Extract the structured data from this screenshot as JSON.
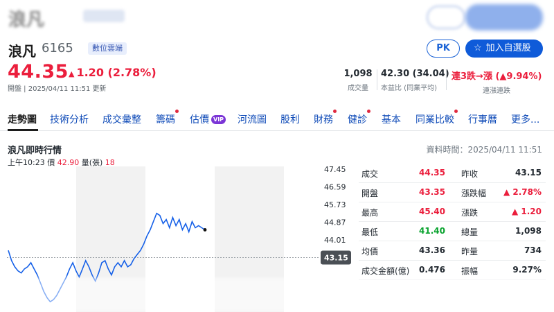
{
  "stock": {
    "name": "浪凡",
    "code": "6165",
    "tag": "數位雲端",
    "price": "44.35",
    "change": "1.20 (2.78%)",
    "status": "開盤 | 2025/04/11 11:51 更新"
  },
  "buttons": {
    "pk": "PK",
    "add": "加入自選股"
  },
  "metrics": [
    {
      "value": "1,098",
      "label": "成交量"
    },
    {
      "value": "42.30 (34.04)",
      "label": "本益比 (同業平均)"
    },
    {
      "value": "連3跌→漲 (▲9.94%)",
      "label": "連漲連跌"
    }
  ],
  "nav": [
    {
      "label": "走勢圖",
      "active": true
    },
    {
      "label": "技術分析"
    },
    {
      "label": "成交彙整"
    },
    {
      "label": "籌碼",
      "dot": true
    },
    {
      "label": "估價",
      "vip": "VIP"
    },
    {
      "label": "河流圖"
    },
    {
      "label": "股利"
    },
    {
      "label": "財務",
      "dot": true
    },
    {
      "label": "健診",
      "dot": true
    },
    {
      "label": "基本"
    },
    {
      "label": "同業比較",
      "dot": true
    },
    {
      "label": "行事曆"
    },
    {
      "label": "更多..."
    }
  ],
  "realtime": {
    "title": "浪凡即時行情",
    "data_time": "資料時間：2025/04/11 11:51",
    "tick_time": "上午10:23",
    "price_label": "價",
    "price_value": "42.90",
    "vol_label": "量(張)",
    "vol_value": "18"
  },
  "chart_data": {
    "type": "line",
    "y_ticks": [
      "47.45",
      "46.59",
      "45.73",
      "44.87",
      "44.01",
      "43.15"
    ],
    "ylim": [
      40.5,
      47.45
    ],
    "reference": 43.15,
    "reference_label": "43.15",
    "series": [
      {
        "values": [
          43.5,
          43.0,
          42.7,
          42.5,
          42.4,
          42.6,
          42.7,
          42.9,
          42.6,
          42.3,
          41.9,
          41.5,
          41.2,
          41.0,
          41.1,
          41.3,
          41.6,
          41.9,
          42.2,
          42.6,
          42.9,
          42.5,
          42.2,
          42.6,
          43.0,
          42.7,
          42.3,
          42.0,
          42.4,
          42.9,
          43.0,
          42.6,
          42.3,
          42.7,
          42.9,
          42.7,
          43.0,
          42.7,
          42.8,
          43.1,
          43.3,
          43.5,
          43.8,
          44.2,
          44.5,
          44.9,
          45.3,
          45.2,
          44.8,
          45.0,
          44.6,
          45.1,
          44.7,
          45.0,
          44.5,
          44.8,
          44.4,
          44.9,
          44.6,
          44.7,
          44.6,
          44.5
        ]
      }
    ]
  },
  "stats": [
    {
      "l1": "成交",
      "v1": "44.35",
      "c1": "red",
      "l2": "昨收",
      "v2": "43.15",
      "c2": ""
    },
    {
      "l1": "開盤",
      "v1": "43.35",
      "c1": "red",
      "l2": "漲跌幅",
      "v2": "▲ 2.78%",
      "c2": "red"
    },
    {
      "l1": "最高",
      "v1": "45.40",
      "c1": "red",
      "l2": "漲跌",
      "v2": "▲ 1.20",
      "c2": "red"
    },
    {
      "l1": "最低",
      "v1": "41.40",
      "c1": "green",
      "l2": "總量",
      "v2": "1,098",
      "c2": ""
    },
    {
      "l1": "均價",
      "v1": "43.36",
      "c1": "",
      "l2": "昨量",
      "v2": "734",
      "c2": ""
    },
    {
      "l1": "成交金額(億)",
      "v1": "0.476",
      "c1": "",
      "l2": "振幅",
      "v2": "9.27%",
      "c2": ""
    }
  ],
  "colors": {
    "up": "#eb1e3c",
    "down": "#09a32e",
    "line": "#1560e8",
    "link": "#0f4bb8"
  }
}
